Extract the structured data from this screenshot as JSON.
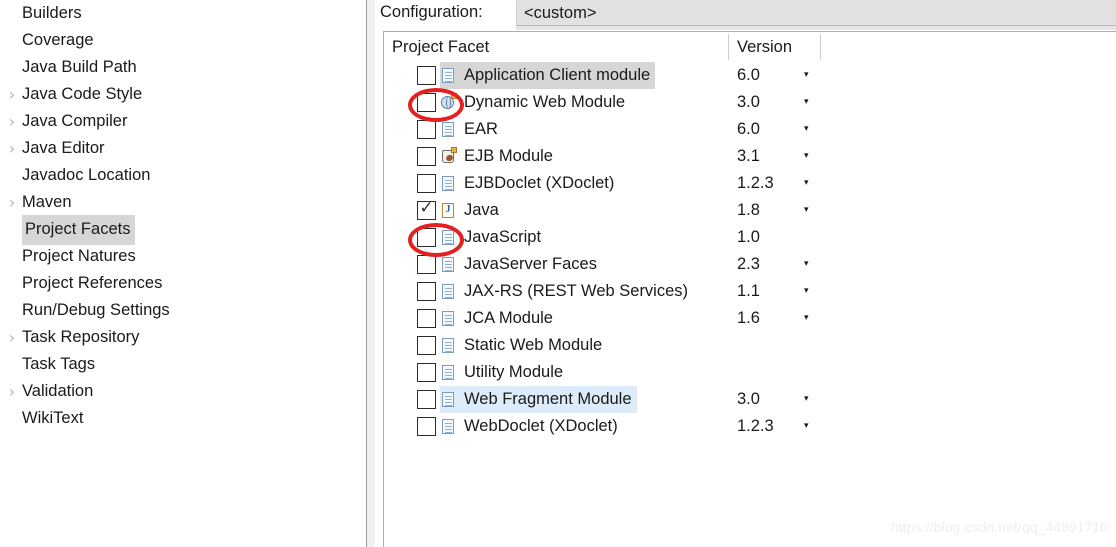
{
  "preferences_tree": {
    "items": [
      {
        "label": "Builders",
        "expandable": false,
        "selected": false
      },
      {
        "label": "Coverage",
        "expandable": false,
        "selected": false
      },
      {
        "label": "Java Build Path",
        "expandable": false,
        "selected": false
      },
      {
        "label": "Java Code Style",
        "expandable": true,
        "selected": false
      },
      {
        "label": "Java Compiler",
        "expandable": true,
        "selected": false
      },
      {
        "label": "Java Editor",
        "expandable": true,
        "selected": false
      },
      {
        "label": "Javadoc Location",
        "expandable": false,
        "selected": false
      },
      {
        "label": "Maven",
        "expandable": true,
        "selected": false
      },
      {
        "label": "Project Facets",
        "expandable": false,
        "selected": true
      },
      {
        "label": "Project Natures",
        "expandable": false,
        "selected": false
      },
      {
        "label": "Project References",
        "expandable": false,
        "selected": false
      },
      {
        "label": "Run/Debug Settings",
        "expandable": false,
        "selected": false
      },
      {
        "label": "Task Repository",
        "expandable": true,
        "selected": false
      },
      {
        "label": "Task Tags",
        "expandable": false,
        "selected": false
      },
      {
        "label": "Validation",
        "expandable": true,
        "selected": false
      },
      {
        "label": "WikiText",
        "expandable": false,
        "selected": false
      }
    ],
    "expand_arrow_glyph": "›"
  },
  "configuration": {
    "label": "Configuration:",
    "value": "<custom>"
  },
  "facet_table": {
    "columns": {
      "facet": "Project Facet",
      "version": "Version"
    },
    "checked_glyph": "✓",
    "dropdown_glyph": "▾",
    "rows": [
      {
        "name": "Application Client module",
        "version": "6.0",
        "checked": false,
        "icon": "document-icon",
        "has_dropdown": true,
        "highlight": "gray"
      },
      {
        "name": "Dynamic Web Module",
        "version": "3.0",
        "checked": false,
        "icon": "web-module-icon",
        "has_dropdown": true,
        "highlight": "none"
      },
      {
        "name": "EAR",
        "version": "6.0",
        "checked": false,
        "icon": "document-icon",
        "has_dropdown": true,
        "highlight": "none"
      },
      {
        "name": "EJB Module",
        "version": "3.1",
        "checked": false,
        "icon": "ejb-bean-icon",
        "has_dropdown": true,
        "highlight": "none"
      },
      {
        "name": "EJBDoclet (XDoclet)",
        "version": "1.2.3",
        "checked": false,
        "icon": "document-icon",
        "has_dropdown": true,
        "highlight": "none"
      },
      {
        "name": "Java",
        "version": "1.8",
        "checked": true,
        "icon": "java-file-icon",
        "has_dropdown": true,
        "highlight": "none"
      },
      {
        "name": "JavaScript",
        "version": "1.0",
        "checked": false,
        "icon": "document-icon",
        "has_dropdown": false,
        "highlight": "none"
      },
      {
        "name": "JavaServer Faces",
        "version": "2.3",
        "checked": false,
        "icon": "document-icon",
        "has_dropdown": true,
        "highlight": "none"
      },
      {
        "name": "JAX-RS (REST Web Services)",
        "version": "1.1",
        "checked": false,
        "icon": "document-icon",
        "has_dropdown": true,
        "highlight": "none"
      },
      {
        "name": "JCA Module",
        "version": "1.6",
        "checked": false,
        "icon": "document-icon",
        "has_dropdown": true,
        "highlight": "none"
      },
      {
        "name": "Static Web Module",
        "version": "",
        "checked": false,
        "icon": "document-icon",
        "has_dropdown": false,
        "highlight": "none"
      },
      {
        "name": "Utility Module",
        "version": "",
        "checked": false,
        "icon": "document-icon",
        "has_dropdown": false,
        "highlight": "none"
      },
      {
        "name": "Web Fragment Module",
        "version": "3.0",
        "checked": false,
        "icon": "document-icon",
        "has_dropdown": true,
        "highlight": "blue"
      },
      {
        "name": "WebDoclet (XDoclet)",
        "version": "1.2.3",
        "checked": false,
        "icon": "document-icon",
        "has_dropdown": true,
        "highlight": "none"
      }
    ]
  },
  "annotations": {
    "ellipses": [
      {
        "target": "Dynamic Web Module checkbox",
        "color": "#e41f1f"
      },
      {
        "target": "JavaScript checkbox",
        "color": "#e41f1f"
      }
    ]
  },
  "watermark": {
    "text": "https://blog.csdn.net/qq_44991710"
  },
  "colors": {
    "selection_gray": "#d6d6d6",
    "hover_blue": "#dcecfa",
    "annotation_red": "#e41f1f",
    "combo_bg": "#e1e1e1"
  }
}
